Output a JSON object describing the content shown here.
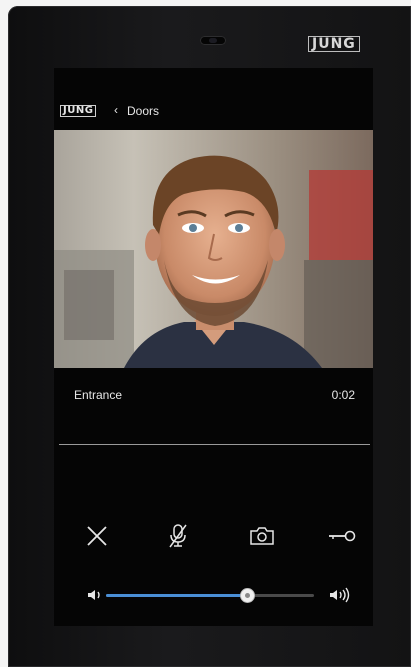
{
  "device": {
    "brand": "JUNG"
  },
  "header": {
    "logo": "JUNG",
    "back_symbol": "‹",
    "breadcrumb": "Doors"
  },
  "call": {
    "caller_name": "Entrance",
    "duration": "0:02"
  },
  "controls": {
    "icons": [
      "close-icon",
      "microphone-muted-icon",
      "camera-icon",
      "door-key-icon"
    ]
  },
  "volume": {
    "level_percent": 68,
    "accent_color": "#4a8fd6",
    "low_icon": "volume-low-icon",
    "high_icon": "volume-high-icon"
  }
}
